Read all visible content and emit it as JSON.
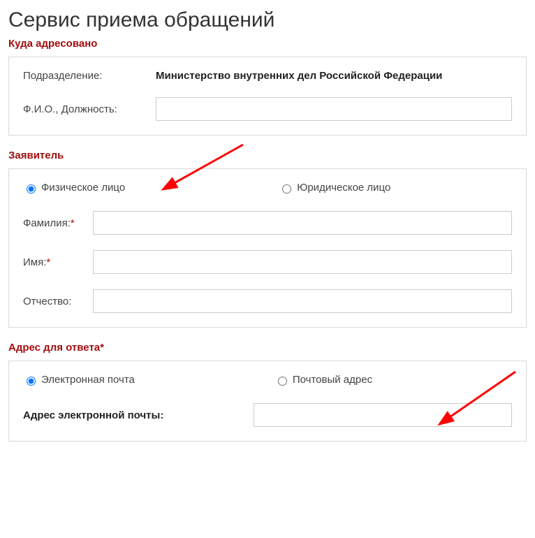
{
  "page_title": "Сервис приема обращений",
  "sections": {
    "addressed": {
      "title": "Куда адресовано",
      "department_label": "Подразделение:",
      "department_value": "Министерство внутренних дел Российской Федерации",
      "fio_label": "Ф.И.О., Должность:"
    },
    "applicant": {
      "title": "Заявитель",
      "option_individual": "Физическое лицо",
      "option_legal": "Юридическое лицо",
      "surname_label": "Фамилия:",
      "name_label": "Имя:",
      "patronymic_label": "Отчество:"
    },
    "reply": {
      "title": "Адрес для ответа",
      "option_email": "Электронная почта",
      "option_postal": "Почтовый адрес",
      "email_label": "Адрес электронной почты:"
    }
  }
}
